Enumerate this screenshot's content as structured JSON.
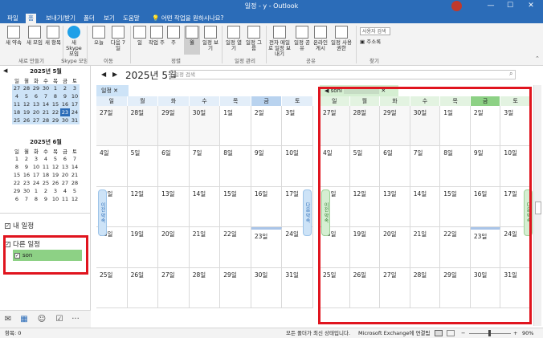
{
  "titlebar": {
    "title": "일정 - y",
    "title_suffix": "- Outlook",
    "minimize": "—",
    "maximize": "☐",
    "close": "✕"
  },
  "ribbon_tabs": [
    "파일",
    "홈",
    "보내기/받기",
    "폴더",
    "보기",
    "도움말",
    "어떤 작업을 원하시나요?"
  ],
  "ribbon": {
    "groups": [
      {
        "label": "새로 만들기",
        "buttons": [
          "새 약속",
          "새 모임",
          "새 항목"
        ]
      },
      {
        "label": "Skype 모임",
        "buttons": [
          "새 Skype 모임"
        ]
      },
      {
        "label": "이동",
        "buttons": [
          "오늘",
          "다음 7일"
        ]
      },
      {
        "label": "정렬",
        "buttons": [
          "일",
          "작업 주",
          "주",
          "",
          "월",
          "일정 보기"
        ]
      },
      {
        "label": "일정 관리",
        "buttons": [
          "일정 열기",
          "일정 그룹"
        ]
      },
      {
        "label": "공유",
        "buttons": [
          "전자 메일로 일정 보내기",
          "일정 공유",
          "온라인 게시",
          "일정 사용 권한"
        ]
      },
      {
        "label": "찾기",
        "buttons": [
          "사용자 검색",
          "주소록"
        ]
      }
    ]
  },
  "minical_may": {
    "title": "2025년 5월",
    "dow": [
      "일",
      "월",
      "화",
      "수",
      "목",
      "금",
      "토"
    ],
    "weeks": [
      [
        "27",
        "28",
        "29",
        "30",
        "1",
        "2",
        "3"
      ],
      [
        "4",
        "5",
        "6",
        "7",
        "8",
        "9",
        "10"
      ],
      [
        "11",
        "12",
        "13",
        "14",
        "15",
        "16",
        "17"
      ],
      [
        "18",
        "19",
        "20",
        "21",
        "22",
        "23",
        "24"
      ],
      [
        "25",
        "26",
        "27",
        "28",
        "29",
        "30",
        "31"
      ]
    ],
    "today": "23"
  },
  "minical_june": {
    "title": "2025년 6월",
    "dow": [
      "일",
      "월",
      "화",
      "수",
      "목",
      "금",
      "토"
    ],
    "weeks": [
      [
        "1",
        "2",
        "3",
        "4",
        "5",
        "6",
        "7"
      ],
      [
        "8",
        "9",
        "10",
        "11",
        "12",
        "13",
        "14"
      ],
      [
        "15",
        "16",
        "17",
        "18",
        "19",
        "20",
        "21"
      ],
      [
        "22",
        "23",
        "24",
        "25",
        "26",
        "27",
        "28"
      ],
      [
        "29",
        "30",
        "1",
        "2",
        "3",
        "4",
        "5"
      ],
      [
        "6",
        "7",
        "8",
        "9",
        "10",
        "11",
        "12"
      ]
    ]
  },
  "folders": {
    "my_calendars": "내 일정",
    "other_calendars": "다른 일정",
    "other_item": "son"
  },
  "main": {
    "month_title": "2025년 5월",
    "search_placeholder": "일정 검색",
    "prev": "◀",
    "next": "▶"
  },
  "calendar1": {
    "tab": "일정",
    "side_label": "이전 약속",
    "dow": [
      "일",
      "월",
      "화",
      "수",
      "목",
      "금",
      "토"
    ],
    "weeks": [
      [
        "27일",
        "28일",
        "29일",
        "30일",
        "1일",
        "2일",
        "3일"
      ],
      [
        "4일",
        "5일",
        "6일",
        "7일",
        "8일",
        "9일",
        "10일"
      ],
      [
        "11일",
        "12일",
        "13일",
        "14일",
        "15일",
        "16일",
        "17일"
      ],
      [
        "18일",
        "19일",
        "20일",
        "21일",
        "22일",
        "23일",
        "24일"
      ],
      [
        "25일",
        "26일",
        "27일",
        "28일",
        "29일",
        "30일",
        "31일"
      ]
    ]
  },
  "calendar2": {
    "tab": "sonl",
    "side_label_left": "이전 약속",
    "side_label_right": "다음 약속",
    "dow": [
      "일",
      "월",
      "화",
      "수",
      "목",
      "금",
      "토"
    ],
    "weeks": [
      [
        "27일",
        "28일",
        "29일",
        "30일",
        "1일",
        "2일",
        "3일"
      ],
      [
        "4일",
        "5일",
        "6일",
        "7일",
        "8일",
        "9일",
        "10일"
      ],
      [
        "11일",
        "12일",
        "13일",
        "14일",
        "15일",
        "16일",
        "17일"
      ],
      [
        "18일",
        "19일",
        "20일",
        "21일",
        "22일",
        "23일",
        "24일"
      ],
      [
        "25일",
        "26일",
        "27일",
        "28일",
        "29일",
        "30일",
        "31일"
      ]
    ]
  },
  "statusbar": {
    "items": "항목: 0",
    "sync": "모든 폴더가 최신 상태입니다.",
    "connection": "Microsoft Exchange에 연결됨",
    "zoom": "90%"
  },
  "colors": {
    "accent": "#2b6cb8",
    "cal1_header": "#cde3f7",
    "cal2_header": "#d5efd2",
    "today_friday_cal2": "#8dd185",
    "highlight_box": "#e0141e"
  }
}
